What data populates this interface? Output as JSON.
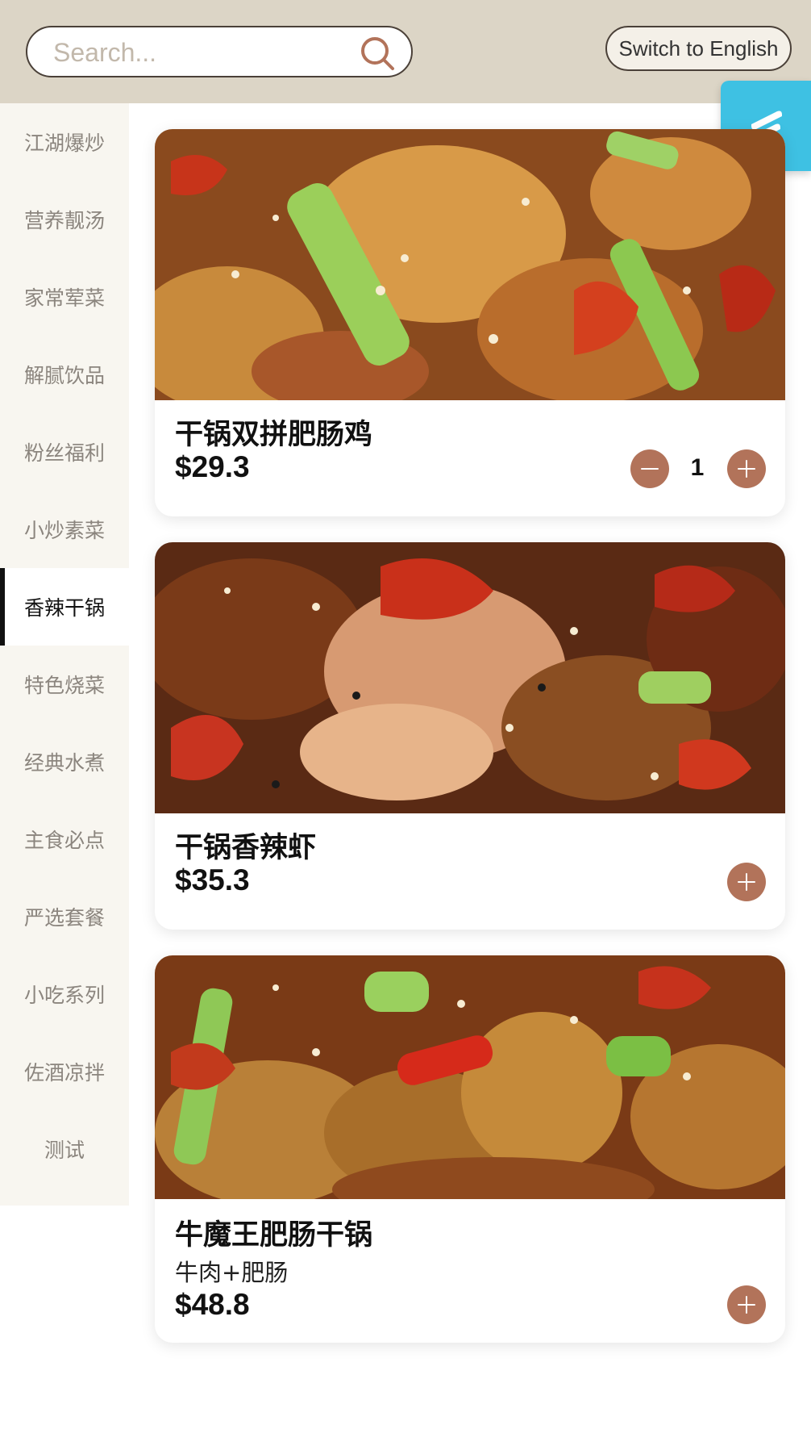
{
  "header": {
    "search_placeholder": "Search...",
    "language_button": "Switch to English"
  },
  "sidebar": {
    "categories": [
      {
        "label": "江湖爆炒"
      },
      {
        "label": "营养靓汤"
      },
      {
        "label": "家常荤菜"
      },
      {
        "label": "解腻饮品"
      },
      {
        "label": "粉丝福利"
      },
      {
        "label": "小炒素菜"
      },
      {
        "label": "香辣干锅",
        "active": true
      },
      {
        "label": "特色烧菜"
      },
      {
        "label": "经典水煮"
      },
      {
        "label": "主食必点"
      },
      {
        "label": "严选套餐"
      },
      {
        "label": "小吃系列"
      },
      {
        "label": "佐酒凉拌"
      },
      {
        "label": "测试"
      }
    ]
  },
  "dishes": [
    {
      "name": "干锅双拼肥肠鸡",
      "price": "$29.3",
      "quantity": "1"
    },
    {
      "name": "干锅香辣虾",
      "price": "$35.3"
    },
    {
      "name": "牛魔王肥肠干锅",
      "description": "牛肉+肥肠",
      "price": "$48.8"
    }
  ],
  "colors": {
    "header_bg": "#dcd5c6",
    "sidebar_bg": "#f8f6f0",
    "accent_button": "#b2735a",
    "float_button": "#3ec1e3"
  },
  "icons": {
    "search": "search-icon",
    "minus": "minus-icon",
    "plus": "plus-icon",
    "float": "brand-s-icon"
  }
}
